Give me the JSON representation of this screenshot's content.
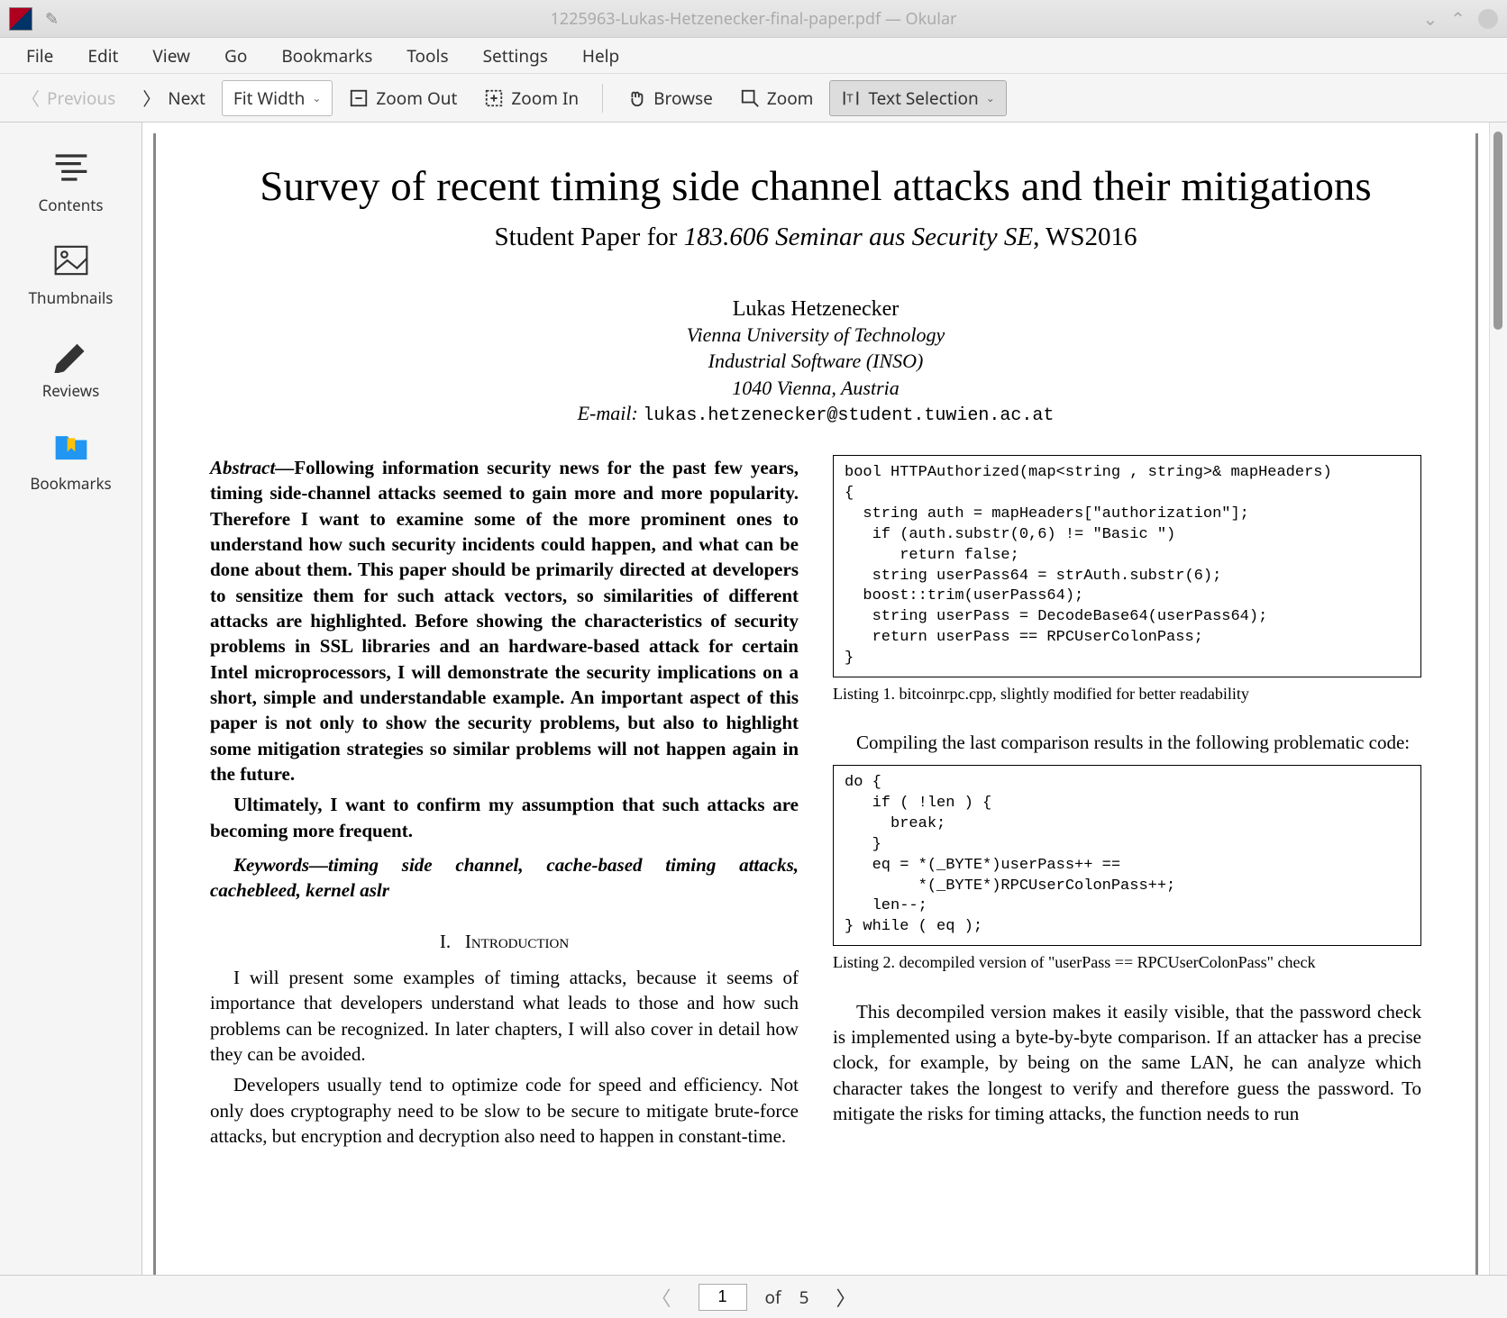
{
  "window": {
    "title": "1225963-Lukas-Hetzenecker-final-paper.pdf — Okular"
  },
  "menubar": [
    "File",
    "Edit",
    "View",
    "Go",
    "Bookmarks",
    "Tools",
    "Settings",
    "Help"
  ],
  "toolbar": {
    "previous": "Previous",
    "next": "Next",
    "zoom_mode": "Fit Width",
    "zoom_out": "Zoom Out",
    "zoom_in": "Zoom In",
    "browse": "Browse",
    "zoom": "Zoom",
    "text_selection": "Text Selection"
  },
  "sidebar": {
    "items": [
      {
        "label": "Contents"
      },
      {
        "label": "Thumbnails"
      },
      {
        "label": "Reviews"
      },
      {
        "label": "Bookmarks"
      }
    ]
  },
  "pagenav": {
    "current": "1",
    "of_label": "of",
    "total": "5"
  },
  "document": {
    "title": "Survey of recent timing side channel attacks and their mitigations",
    "subtitle_prefix": "Student Paper for ",
    "subtitle_italic": "183.606 Seminar aus Security SE",
    "subtitle_suffix": ", WS2016",
    "author": "Lukas Hetzenecker",
    "affiliation": "Vienna University of Technology\nIndustrial Software (INSO)\n1040 Vienna, Austria",
    "email_label": "E-mail: ",
    "email": "lukas.hetzenecker@student.tuwien.ac.at",
    "abstract_label": "Abstract—",
    "abstract": "Following information security news for the past few years, timing side-channel attacks seemed to gain more and more popularity. Therefore I want to examine some of the more prominent ones to understand how such security incidents could happen, and what can be done about them. This paper should be primarily directed at developers to sensitize them for such attack vectors, so similarities of different attacks are highlighted. Before showing the characteristics of security problems in SSL libraries and an hardware-based attack for certain Intel microprocessors, I will demonstrate the security implications on a short, simple and understandable example. An important aspect of this paper is not only to show the security problems, but also to highlight some mitigation strategies so similar problems will not happen again in the future.",
    "abstract_p2": "Ultimately, I want to confirm my assumption that such attacks are becoming more frequent.",
    "keywords_label": "Keywords—",
    "keywords": "timing side channel, cache-based timing attacks, cachebleed, kernel aslr",
    "section1_num": "I.",
    "section1_title": "Introduction",
    "intro_p1": "I will present some examples of timing attacks, because it seems of importance that developers understand what leads to those and how such problems can be recognized. In later chapters, I will also cover in detail how they can be avoided.",
    "intro_p2": "Developers usually tend to optimize code for speed and efficiency. Not only does cryptography need to be slow to be secure to mitigate brute-force attacks, but encryption and decryption also need to happen in constant-time.",
    "listing1_code": "bool HTTPAuthorized(map<string , string>& mapHeaders)\n{\n  string auth = mapHeaders[\"authorization\"];\n   if (auth.substr(0,6) != \"Basic \")\n      return false;\n   string userPass64 = strAuth.substr(6);\n  boost::trim(userPass64);\n   string userPass = DecodeBase64(userPass64);\n   return userPass == RPCUserColonPass;\n}",
    "listing1_caption": "Listing 1.   bitcoinrpc.cpp, slightly modified for better readability",
    "right_p1": "Compiling the last comparison results in the following problematic code:",
    "listing2_code": "do {\n   if ( !len ) {\n     break;\n   }\n   eq = *(_BYTE*)userPass++ ==\n        *(_BYTE*)RPCUserColonPass++;\n   len--;\n} while ( eq );",
    "listing2_caption": "Listing 2.   decompiled version of \"userPass == RPCUserColonPass\" check",
    "right_p2": "This decompiled version makes it easily visible, that the password check is implemented using a byte-by-byte comparison. If an attacker has a precise clock, for example, by being on the same LAN, he can analyze which character takes the longest to verify and therefore guess the password. To mitigate the risks for timing attacks, the function needs to run"
  }
}
